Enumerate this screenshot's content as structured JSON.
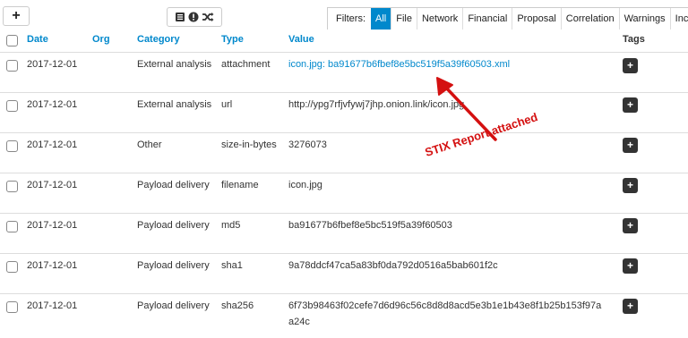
{
  "toolbar": {
    "add_label": "+",
    "filters_label": "Filters:",
    "filters": [
      {
        "label": "All",
        "active": true
      },
      {
        "label": "File"
      },
      {
        "label": "Network"
      },
      {
        "label": "Financial"
      },
      {
        "label": "Proposal"
      },
      {
        "label": "Correlation"
      },
      {
        "label": "Warnings"
      },
      {
        "label": "Inc"
      }
    ]
  },
  "table": {
    "headers": {
      "date": "Date",
      "org": "Org",
      "category": "Category",
      "type": "Type",
      "value": "Value",
      "tags": "Tags"
    },
    "rows": [
      {
        "date": "2017-12-01",
        "org": "",
        "category": "External analysis",
        "type": "attachment",
        "value": "icon.jpg: ba91677b6fbef8e5bc519f5a39f60503.xml",
        "value_link": true
      },
      {
        "date": "2017-12-01",
        "org": "",
        "category": "External analysis",
        "type": "url",
        "value": "http://ypg7rfjvfywj7jhp.onion.link/icon.jpg"
      },
      {
        "date": "2017-12-01",
        "org": "",
        "category": "Other",
        "type": "size-in-bytes",
        "value": "3276073"
      },
      {
        "date": "2017-12-01",
        "org": "",
        "category": "Payload delivery",
        "type": "filename",
        "value": "icon.jpg"
      },
      {
        "date": "2017-12-01",
        "org": "",
        "category": "Payload delivery",
        "type": "md5",
        "value": "ba91677b6fbef8e5bc519f5a39f60503"
      },
      {
        "date": "2017-12-01",
        "org": "",
        "category": "Payload delivery",
        "type": "sha1",
        "value": "9a78ddcf47ca5a83bf0da792d0516a5bab601f2c"
      },
      {
        "date": "2017-12-01",
        "org": "",
        "category": "Payload delivery",
        "type": "sha256",
        "value": "6f73b98463f02cefe7d6d96c56c8d8d8acd5e3b1e1b43e8f1b25b153f97a",
        "value_line2": "a24c"
      }
    ],
    "tag_button_label": "+"
  },
  "annotation": {
    "text": "STIX Report attached",
    "color": "#d41010"
  },
  "colors": {
    "accent": "#0088cc",
    "tag_button": "#333333"
  }
}
